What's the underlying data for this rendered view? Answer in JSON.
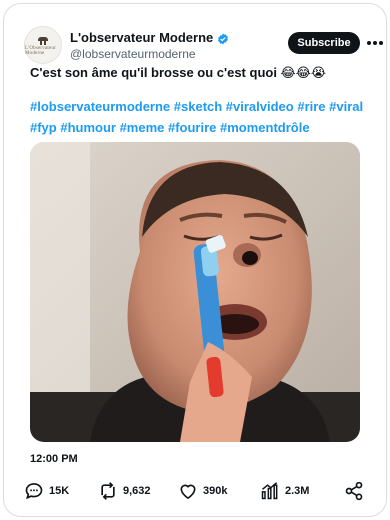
{
  "account": {
    "display_name": "L'observateur Moderne",
    "handle": "@lobservateurmoderne",
    "avatar_text": "L'Observateur Moderne"
  },
  "header": {
    "subscribe_label": "Subscribe"
  },
  "post": {
    "caption": "C'est son âme qu'il brosse ou c'est quoi 😂😂😭",
    "hashtags": "#lobservateurmoderne #sketch #viralvideo #rire #viral #fyp #humour #meme #fourire #momentdrôle",
    "timestamp": "12:00 PM"
  },
  "stats": {
    "replies": "15K",
    "reposts": "9,632",
    "likes": "390k",
    "views": "2.3M"
  },
  "colors": {
    "accent": "#1d9bf0",
    "text": "#0f1419",
    "muted": "#536471",
    "button": "#0f1419"
  },
  "icons": [
    "verified-badge-icon",
    "more-options-icon",
    "reply-icon",
    "repost-icon",
    "like-icon",
    "views-icon",
    "share-icon"
  ]
}
